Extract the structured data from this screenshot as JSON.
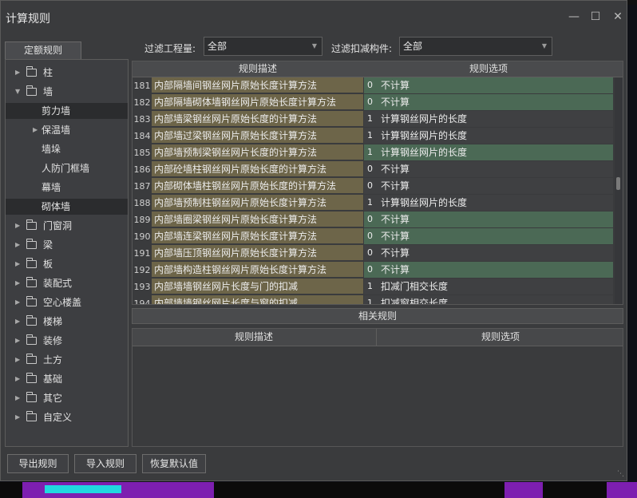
{
  "window": {
    "title": "计算规则",
    "minimize_icon": "minimize-icon",
    "maximize_icon": "maximize-icon",
    "close_icon": "close-icon"
  },
  "left_panel": {
    "tab_label": "定额规则",
    "tree": [
      {
        "label": "柱",
        "level": 0,
        "expandable": true,
        "expanded": false,
        "selected": false
      },
      {
        "label": "墙",
        "level": 0,
        "expandable": true,
        "expanded": true,
        "selected": false
      },
      {
        "label": "剪力墙",
        "level": 1,
        "expandable": false,
        "selected": true
      },
      {
        "label": "保温墙",
        "level": 1,
        "expandable": true,
        "expanded": false,
        "selected": false
      },
      {
        "label": "墙垛",
        "level": 1,
        "expandable": false,
        "selected": false
      },
      {
        "label": "人防门框墙",
        "level": 1,
        "expandable": false,
        "selected": false
      },
      {
        "label": "幕墙",
        "level": 1,
        "expandable": false,
        "selected": false
      },
      {
        "label": "砌体墙",
        "level": 1,
        "expandable": false,
        "selected": true
      },
      {
        "label": "门窗洞",
        "level": 0,
        "expandable": true,
        "expanded": false,
        "selected": false
      },
      {
        "label": "梁",
        "level": 0,
        "expandable": true,
        "expanded": false,
        "selected": false
      },
      {
        "label": "板",
        "level": 0,
        "expandable": true,
        "expanded": false,
        "selected": false
      },
      {
        "label": "装配式",
        "level": 0,
        "expandable": true,
        "expanded": false,
        "selected": false
      },
      {
        "label": "空心楼盖",
        "level": 0,
        "expandable": true,
        "expanded": false,
        "selected": false
      },
      {
        "label": "楼梯",
        "level": 0,
        "expandable": true,
        "expanded": false,
        "selected": false
      },
      {
        "label": "装修",
        "level": 0,
        "expandable": true,
        "expanded": false,
        "selected": false
      },
      {
        "label": "土方",
        "level": 0,
        "expandable": true,
        "expanded": false,
        "selected": false
      },
      {
        "label": "基础",
        "level": 0,
        "expandable": true,
        "expanded": false,
        "selected": false
      },
      {
        "label": "其它",
        "level": 0,
        "expandable": true,
        "expanded": false,
        "selected": false
      },
      {
        "label": "自定义",
        "level": 0,
        "expandable": true,
        "expanded": false,
        "selected": false
      }
    ]
  },
  "filters": {
    "quantity_label": "过滤工程量:",
    "quantity_value": "全部",
    "deduct_label": "过滤扣减构件:",
    "deduct_value": "全部"
  },
  "rules_grid": {
    "col_desc": "规则描述",
    "col_option": "规则选项",
    "rows": [
      {
        "n": "181",
        "desc": "内部隔墙间钢丝网片原始长度计算方法",
        "opt_num": "0",
        "opt_text": "不计算",
        "desc_color": "olive",
        "opt_color": "green"
      },
      {
        "n": "182",
        "desc": "内部隔墙砌体墙钢丝网片原始长度计算方法",
        "opt_num": "0",
        "opt_text": "不计算",
        "desc_color": "olive",
        "opt_color": "green"
      },
      {
        "n": "183",
        "desc": "内部墙梁钢丝网片原始长度的计算方法",
        "opt_num": "1",
        "opt_text": "计算钢丝网片的长度",
        "desc_color": "olive",
        "opt_color": "gray"
      },
      {
        "n": "184",
        "desc": "内部墙过梁钢丝网片原始长度计算方法",
        "opt_num": "1",
        "opt_text": "计算钢丝网片的长度",
        "desc_color": "olive",
        "opt_color": "gray"
      },
      {
        "n": "185",
        "desc": "内部墙预制梁钢丝网片长度的计算方法",
        "opt_num": "1",
        "opt_text": "计算钢丝网片的长度",
        "desc_color": "olive",
        "opt_color": "green"
      },
      {
        "n": "186",
        "desc": "内部砼墙柱钢丝网片原始长度的计算方法",
        "opt_num": "0",
        "opt_text": "不计算",
        "desc_color": "olive",
        "opt_color": "gray"
      },
      {
        "n": "187",
        "desc": "内部砌体墙柱钢丝网片原始长度的计算方法",
        "opt_num": "0",
        "opt_text": "不计算",
        "desc_color": "olive",
        "opt_color": "gray"
      },
      {
        "n": "188",
        "desc": "内部墙预制柱钢丝网片原始长度计算方法",
        "opt_num": "1",
        "opt_text": "计算钢丝网片的长度",
        "desc_color": "olive",
        "opt_color": "gray"
      },
      {
        "n": "189",
        "desc": "内部墙圈梁钢丝网片原始长度计算方法",
        "opt_num": "0",
        "opt_text": "不计算",
        "desc_color": "olive",
        "opt_color": "green"
      },
      {
        "n": "190",
        "desc": "内部墙连梁钢丝网片原始长度计算方法",
        "opt_num": "0",
        "opt_text": "不计算",
        "desc_color": "olive",
        "opt_color": "green"
      },
      {
        "n": "191",
        "desc": "内部墙压顶钢丝网片原始长度计算方法",
        "opt_num": "0",
        "opt_text": "不计算",
        "desc_color": "olive",
        "opt_color": "gray"
      },
      {
        "n": "192",
        "desc": "内部墙构造柱钢丝网片原始长度计算方法",
        "opt_num": "0",
        "opt_text": "不计算",
        "desc_color": "olive",
        "opt_color": "green"
      },
      {
        "n": "193",
        "desc": "内部墙墙钢丝网片长度与门的扣减",
        "opt_num": "1",
        "opt_text": "扣减门相交长度",
        "desc_color": "olive",
        "opt_color": "gray"
      },
      {
        "n": "194",
        "desc": "内部墙墙钢丝网片长度与窗的扣减",
        "opt_num": "1",
        "opt_text": "扣减窗相交长度",
        "desc_color": "olive",
        "opt_color": "gray"
      }
    ]
  },
  "related": {
    "bar_label": "相关规则",
    "col_desc": "规则描述",
    "col_option": "规则选项"
  },
  "buttons": {
    "export": "导出规则",
    "import": "导入规则",
    "restore": "恢复默认值"
  }
}
